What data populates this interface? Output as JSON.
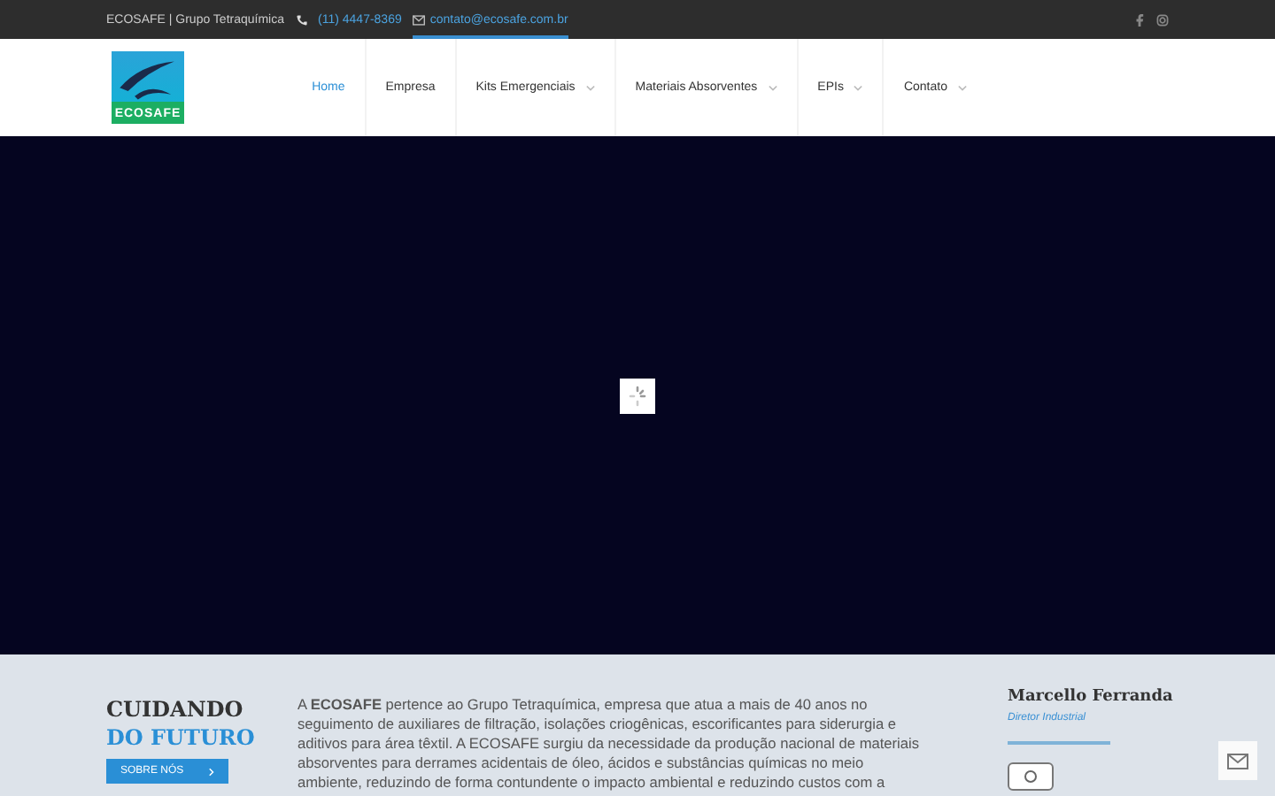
{
  "topbar": {
    "company": "ECOSAFE | Grupo Tetraquímica",
    "phone": "(11) 4447-8369",
    "email": "contato@ecosafe.com.br"
  },
  "logo": {
    "text": "ECOSAFE"
  },
  "nav": [
    {
      "label": "Home",
      "selected": true,
      "dropdown": false
    },
    {
      "label": "Empresa",
      "selected": false,
      "dropdown": false
    },
    {
      "label": "Kits Emergenciais",
      "selected": false,
      "dropdown": true
    },
    {
      "label": "Materiais Absorventes",
      "selected": false,
      "dropdown": true
    },
    {
      "label": "EPIs",
      "selected": false,
      "dropdown": true
    },
    {
      "label": "Contato",
      "selected": false,
      "dropdown": true
    }
  ],
  "about": {
    "title_1": "CUIDANDO",
    "title_2": "DO FUTURO",
    "button": "SOBRE NÓS",
    "text": "A **ECOSAFE** pertence ao Grupo Tetraquímica, empresa que atua a mais de 40 anos no seguimento de auxiliares de filtração, isolações criogênicas, escorificantes para siderurgia e aditivos para área têxtil. A ECOSAFE surgiu da necessidade da produção nacional de materiais absorventes para derrames acidentais de óleo, ácidos e substâncias químicas no meio ambiente, reduzindo de forma contundente o impacto ambiental e reduzindo custos com a"
  },
  "person": {
    "name": "Marcello Ferranda",
    "role": "Diretor Industrial"
  }
}
